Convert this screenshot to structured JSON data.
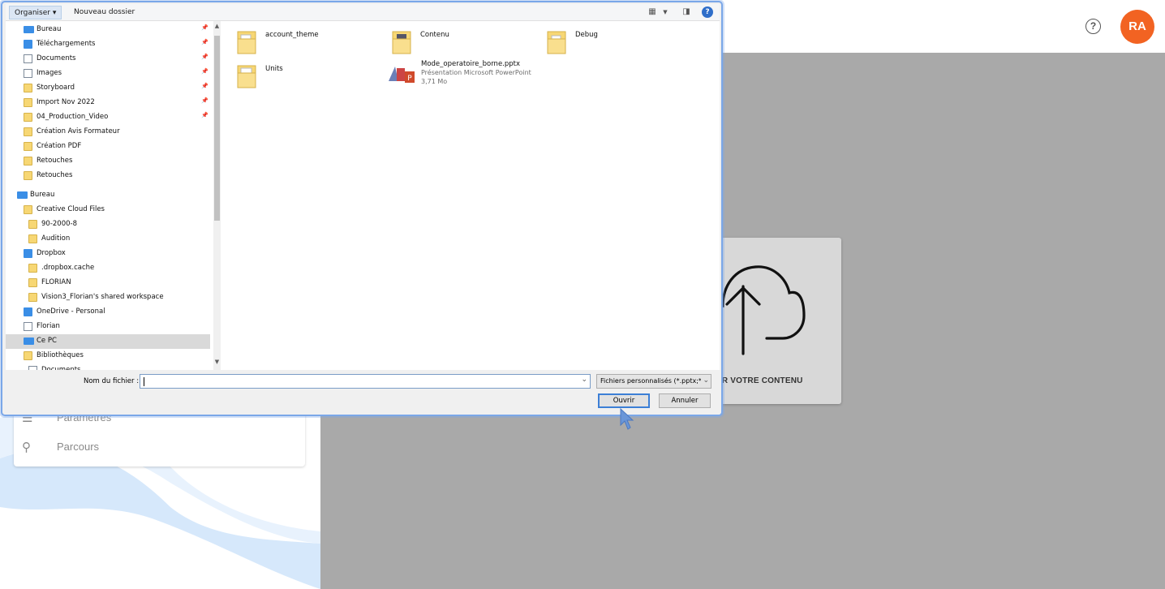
{
  "app": {
    "help_icon": "?",
    "avatar_initials": "RA",
    "avatar_color": "#f26322",
    "sidebar": {
      "items": [
        {
          "label": "Paramètres",
          "icon": "list-icon"
        },
        {
          "label": "Parcours",
          "icon": "route-icon"
        }
      ]
    },
    "upload": {
      "label": "ER VOTRE CONTENU",
      "icon": "cloud-upload-icon"
    }
  },
  "dialog": {
    "toolbar": {
      "organiser": "Organiser ▾",
      "nouveau_dossier": "Nouveau dossier",
      "view_icon": "view-options-icon",
      "pane_icon": "preview-pane-icon",
      "help_icon": "?"
    },
    "nav": [
      {
        "label": "Bureau",
        "icon": "desktop-icon",
        "pinned": true,
        "level": 1
      },
      {
        "label": "Téléchargements",
        "icon": "download-icon",
        "pinned": true,
        "level": 1
      },
      {
        "label": "Documents",
        "icon": "documents-icon",
        "pinned": true,
        "level": 1
      },
      {
        "label": "Images",
        "icon": "images-icon",
        "pinned": true,
        "level": 1
      },
      {
        "label": "Storyboard",
        "icon": "folder-icon",
        "pinned": true,
        "level": 1
      },
      {
        "label": "Import Nov 2022",
        "icon": "folder-icon",
        "pinned": true,
        "level": 1
      },
      {
        "label": "04_Production_Video",
        "icon": "folder-icon",
        "pinned": true,
        "level": 1
      },
      {
        "label": "Création Avis Formateur",
        "icon": "folder-icon",
        "pinned": false,
        "level": 1
      },
      {
        "label": "Création PDF",
        "icon": "folder-icon",
        "pinned": false,
        "level": 1
      },
      {
        "label": "Retouches",
        "icon": "folder-icon",
        "pinned": false,
        "level": 1
      },
      {
        "label": "Retouches",
        "icon": "folder-icon",
        "pinned": false,
        "level": 1
      },
      {
        "label": "Bureau",
        "icon": "desktop-icon",
        "pinned": false,
        "level": 0
      },
      {
        "label": "Creative Cloud Files",
        "icon": "creative-cloud-folder-icon",
        "pinned": false,
        "level": 1
      },
      {
        "label": "90-2000-8",
        "icon": "synced-folder-icon",
        "pinned": false,
        "level": 2
      },
      {
        "label": "Audition",
        "icon": "synced-folder-icon",
        "pinned": false,
        "level": 2
      },
      {
        "label": "Dropbox",
        "icon": "dropbox-icon",
        "pinned": false,
        "level": 1
      },
      {
        "label": ".dropbox.cache",
        "icon": "folder-icon",
        "pinned": false,
        "level": 2
      },
      {
        "label": "FLORIAN",
        "icon": "shared-folder-icon",
        "pinned": false,
        "level": 2
      },
      {
        "label": "Vision3_Florian's shared workspace",
        "icon": "folder-icon",
        "pinned": false,
        "level": 2
      },
      {
        "label": "OneDrive - Personal",
        "icon": "onedrive-icon",
        "pinned": false,
        "level": 1
      },
      {
        "label": "Florian",
        "icon": "user-icon",
        "pinned": false,
        "level": 1
      },
      {
        "label": "Ce PC",
        "icon": "pc-icon",
        "pinned": false,
        "level": 1,
        "selected": true
      },
      {
        "label": "Bibliothèques",
        "icon": "libraries-icon",
        "pinned": false,
        "level": 1
      },
      {
        "label": "Documents",
        "icon": "documents-icon",
        "pinned": false,
        "level": 2
      }
    ],
    "files": [
      {
        "name": "account_theme",
        "icon": "folder-icon"
      },
      {
        "name": "Contenu",
        "icon": "folder-icon"
      },
      {
        "name": "Debug",
        "icon": "folder-icon"
      },
      {
        "name": "Units",
        "icon": "folder-icon"
      },
      {
        "name": "Mode_operatoire_borne.pptx",
        "type": "Présentation Microsoft PowerPoint",
        "size": "3,71 Mo",
        "icon": "powerpoint-file-icon"
      }
    ],
    "filename_label": "Nom du fichier :",
    "filename_value": "",
    "filetype_value": "Fichiers personnalisés (*.pptx;*.",
    "open_button": "Ouvrir",
    "cancel_button": "Annuler"
  }
}
